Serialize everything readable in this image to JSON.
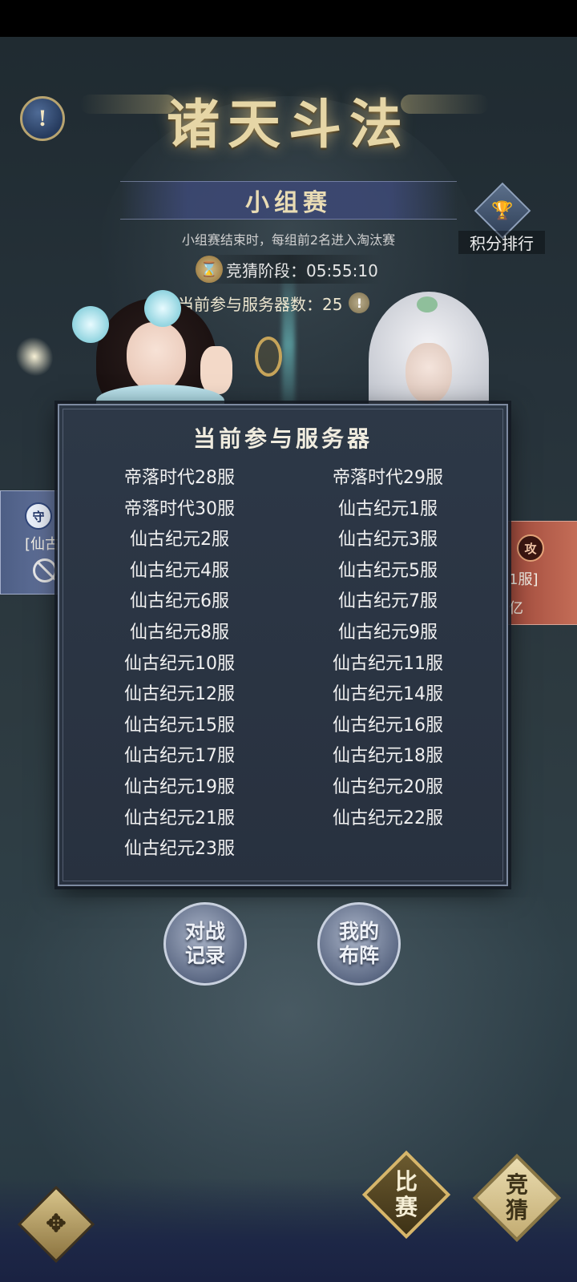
{
  "header": {
    "game_title": "诸天斗法",
    "info_icon": "!"
  },
  "stage": {
    "name": "小组赛",
    "description": "小组赛结束时，每组前2名进入淘汰赛",
    "timer": "竞猜阶段：05:55:10",
    "server_count": "当前参与服务器数：25",
    "server_count_info_icon": "!"
  },
  "ranking": {
    "label": "积分排行",
    "icon": "trophy-icon"
  },
  "side_cards": {
    "left_badge": "守",
    "left_text": "[仙古",
    "right_badge": "攻",
    "right_text": "1服]",
    "right_power": "亿"
  },
  "popup": {
    "title": "当前参与服务器",
    "servers": [
      "帝落时代28服",
      "帝落时代29服",
      "帝落时代30服",
      "仙古纪元1服",
      "仙古纪元2服",
      "仙古纪元3服",
      "仙古纪元4服",
      "仙古纪元5服",
      "仙古纪元6服",
      "仙古纪元7服",
      "仙古纪元8服",
      "仙古纪元9服",
      "仙古纪元10服",
      "仙古纪元11服",
      "仙古纪元12服",
      "仙古纪元14服",
      "仙古纪元15服",
      "仙古纪元16服",
      "仙古纪元17服",
      "仙古纪元18服",
      "仙古纪元19服",
      "仙古纪元20服",
      "仙古纪元21服",
      "仙古纪元22服",
      "仙古纪元23服"
    ]
  },
  "buttons": {
    "battle_log": "对战\n记录",
    "my_formation": "我的\n布阵"
  },
  "bottom_nav": {
    "menu_icon": "✥",
    "match": "比\n赛",
    "bet": "竞\n猜"
  },
  "colors": {
    "gold_text": "#e6d6a6",
    "popup_bg": "#2d3847",
    "popup_border": "#7d8aa0"
  }
}
